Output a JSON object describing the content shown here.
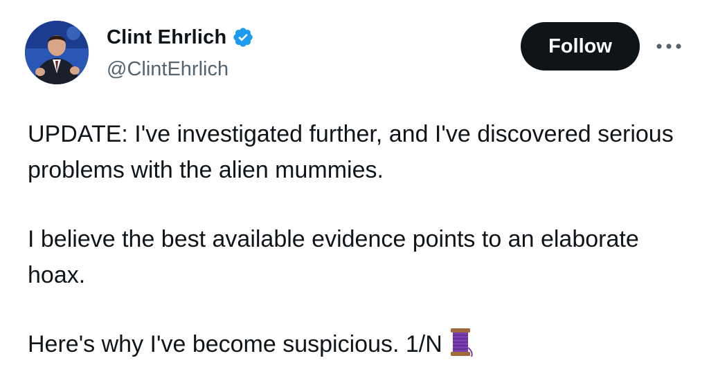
{
  "author": {
    "display_name": "Clint Ehrlich",
    "handle": "@ClintEhrlich",
    "verified": true,
    "verified_icon": "verified-badge-icon",
    "avatar_icon": "profile-photo"
  },
  "actions": {
    "follow_label": "Follow",
    "more_icon": "more-horizontal-icon"
  },
  "tweet": {
    "paragraphs": [
      "UPDATE: I've investigated further, and I've discovered serious problems with the alien mummies.",
      "I believe the best available evidence points to an elaborate hoax.",
      "Here's why I've become suspicious. 1/N"
    ],
    "thread_emoji": "thread-spool-icon"
  },
  "colors": {
    "text": "#0f1419",
    "secondary_text": "#536471",
    "verified_blue": "#1d9bf0",
    "follow_button_bg": "#0f1419",
    "follow_button_text": "#ffffff",
    "spool_purple": "#7b3fb0"
  }
}
